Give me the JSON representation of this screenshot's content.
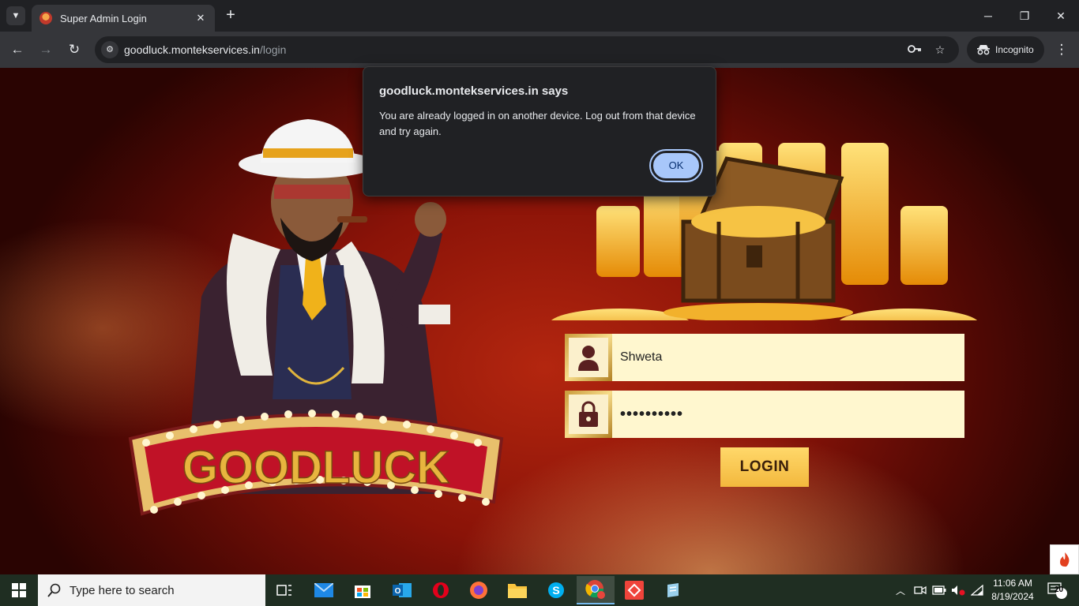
{
  "browser": {
    "tab_title": "Super Admin Login",
    "url_host": "goodluck.montekservices.in",
    "url_path": "/login",
    "incognito_label": "Incognito",
    "icons": [
      "tab-search-icon",
      "close-icon",
      "new-tab-icon",
      "minimize-icon",
      "maximize-icon",
      "back-icon",
      "forward-icon",
      "reload-icon",
      "site-settings-icon",
      "key-icon",
      "star-icon",
      "incognito-icon",
      "more-menu-icon"
    ]
  },
  "dialog": {
    "title": "goodluck.montekservices.in says",
    "message": "You are already logged in on another device. Log out from that device and try again.",
    "ok_label": "OK"
  },
  "login": {
    "logo_text": "GOODLUCK",
    "username_value": "Shweta",
    "password_value": "••••••••••",
    "login_label": "LOGIN"
  },
  "taskbar": {
    "search_placeholder": "Type here to search",
    "time": "11:06 AM",
    "date": "8/19/2024",
    "notification_count": "20",
    "apps": [
      "task-view",
      "mail",
      "microsoft-store",
      "outlook",
      "opera",
      "firefox",
      "file-explorer",
      "skype",
      "chrome",
      "anydesk",
      "notepad"
    ]
  },
  "colors": {
    "accent_blue": "#a8c7fa",
    "login_gold": "#f3b83d",
    "field_bg": "#fff7cf",
    "brand_red": "#b3260f"
  }
}
